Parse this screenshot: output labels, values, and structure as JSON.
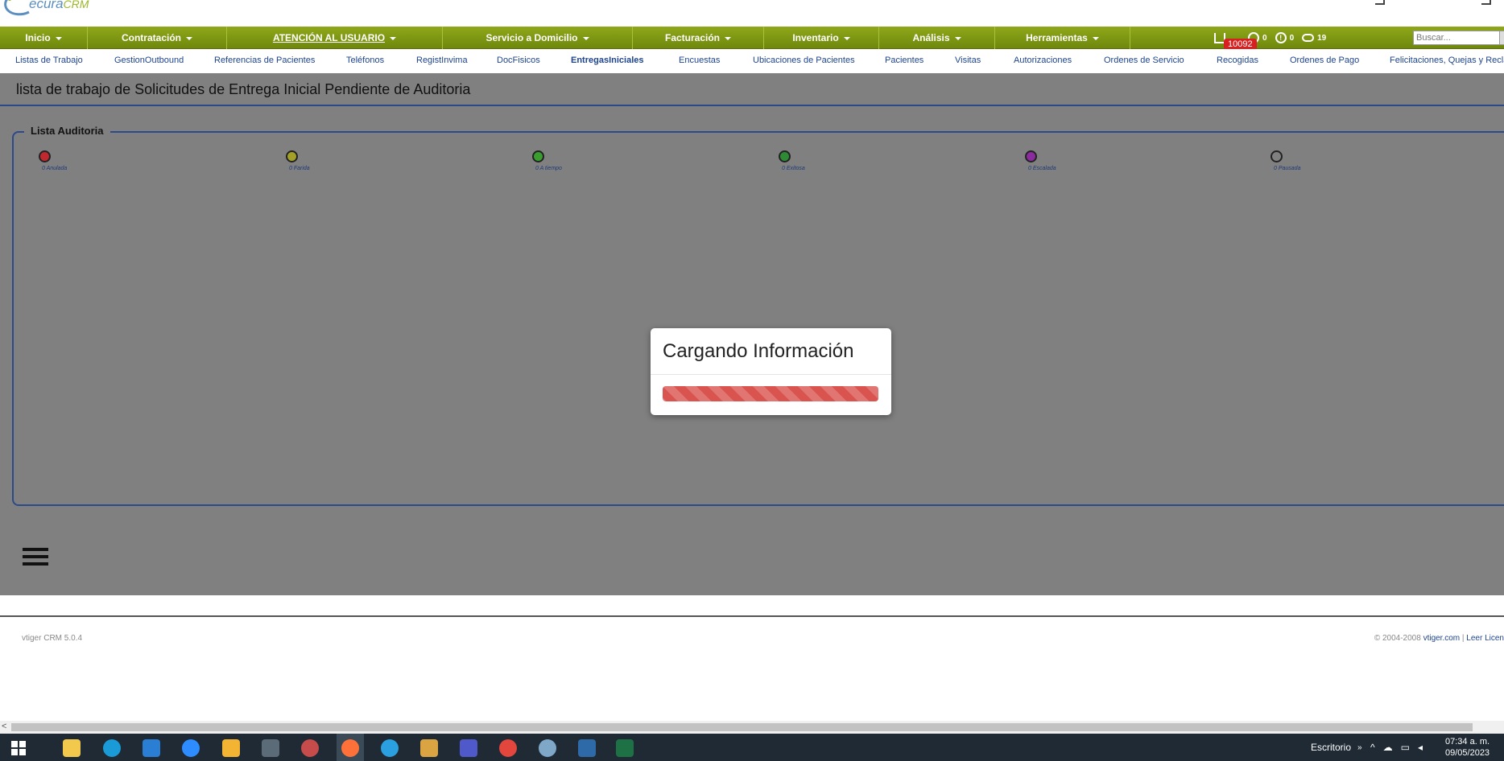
{
  "logo": {
    "text": "ecura",
    "suffix": "CRM"
  },
  "mainnav": {
    "items": [
      {
        "label": "Inicio"
      },
      {
        "label": "Contratación"
      },
      {
        "label": "ATENCIÓN AL USUARIO"
      },
      {
        "label": "Servicio a Domicilio"
      },
      {
        "label": "Facturación"
      },
      {
        "label": "Inventario"
      },
      {
        "label": "Análisis"
      },
      {
        "label": "Herramientas"
      }
    ],
    "badge": "10092",
    "counters": {
      "download": "",
      "users": "0",
      "alerts": "0",
      "messages": "19"
    },
    "search_placeholder": "Buscar..."
  },
  "subnav": {
    "items": [
      "Listas de Trabajo",
      "GestionOutbound",
      "Referencias de Pacientes",
      "Teléfonos",
      "RegistInvima",
      "DocFisicos",
      "EntregasIniciales",
      "Encuestas",
      "Ubicaciones de Pacientes",
      "Pacientes",
      "Visitas",
      "Autorizaciones",
      "Ordenes de Servicio",
      "Recogidas",
      "Ordenes de Pago",
      "Felicitaciones, Quejas y Recla"
    ],
    "active": "EntregasIniciales"
  },
  "page": {
    "title": "lista de trabajo de Solicitudes de Entrega Inicial Pendiente de Auditoria",
    "legend": "Lista Auditoria",
    "statuses": [
      {
        "label": "0 Anulada",
        "color": "#c0282f"
      },
      {
        "label": "0 Farida",
        "color": "#a3a028"
      },
      {
        "label": "0 A tiempo",
        "color": "#3a9e2e"
      },
      {
        "label": "0 Exitosa",
        "color": "#2f8a36"
      },
      {
        "label": "0 Escalada",
        "color": "#8a2c9e"
      },
      {
        "label": "0 Pausada",
        "color": "#808080"
      }
    ]
  },
  "modal": {
    "title": "Cargando Información",
    "progress_color": "#d9534f"
  },
  "footer": {
    "left": "vtiger CRM 5.0.4",
    "right_prefix": "© 2004-2008 ",
    "right_link": "vtiger.com",
    "right_sep": " | ",
    "right_link2": "Leer Licen"
  },
  "taskbar": {
    "escritorio": "Escritorio",
    "time": "07:34 a. m.",
    "date": "09/05/2023"
  }
}
